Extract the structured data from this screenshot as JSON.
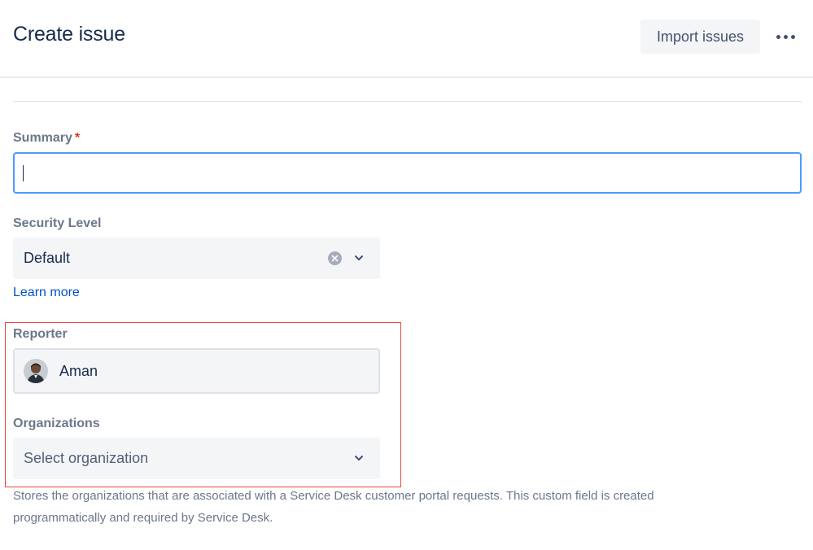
{
  "header": {
    "title": "Create issue",
    "import_label": "Import issues"
  },
  "summary": {
    "label": "Summary",
    "required_mark": "*",
    "value": ""
  },
  "security_level": {
    "label": "Security Level",
    "value": "Default",
    "learn_more": "Learn more"
  },
  "reporter": {
    "label": "Reporter",
    "value": "Aman"
  },
  "organizations": {
    "label": "Organizations",
    "placeholder": "Select organization",
    "helper": "Stores the organizations that are associated with a Service Desk customer portal requests. This custom field is created programmatically and required by Service Desk."
  },
  "colors": {
    "focus_border": "#4c9aff",
    "link": "#0052cc",
    "required": "#de350b",
    "highlight_box": "#e5473a"
  },
  "icons": [
    "more-icon",
    "clear-icon",
    "chevron-down-icon",
    "avatar"
  ]
}
